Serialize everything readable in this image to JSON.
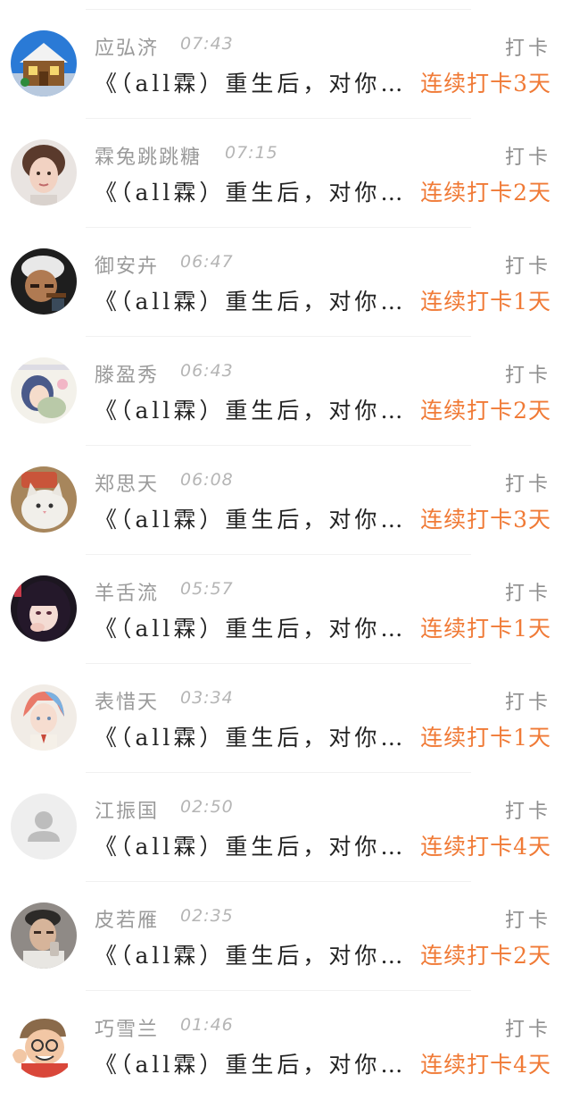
{
  "items": [
    {
      "name": "应弘济",
      "time": "07:43",
      "action": "打卡",
      "title": "《（all霖）重生后，对你…",
      "streak": "连续打卡3天",
      "avatar": "house-avatar"
    },
    {
      "name": "霖兔跳跳糖",
      "time": "07:15",
      "action": "打卡",
      "title": "《（all霖）重生后，对你…",
      "streak": "连续打卡2天",
      "avatar": "boy-portrait-avatar"
    },
    {
      "name": "御安卉",
      "time": "06:47",
      "action": "打卡",
      "title": "《（all霖）重生后，对你…",
      "streak": "连续打卡1天",
      "avatar": "cigar-man-avatar"
    },
    {
      "name": "滕盈秀",
      "time": "06:43",
      "action": "打卡",
      "title": "《（all霖）重生后，对你…",
      "streak": "连续打卡2天",
      "avatar": "anime-girl-avatar"
    },
    {
      "name": "郑思天",
      "time": "06:08",
      "action": "打卡",
      "title": "《（all霖）重生后，对你…",
      "streak": "连续打卡3天",
      "avatar": "cat-avatar"
    },
    {
      "name": "羊舌流",
      "time": "05:57",
      "action": "打卡",
      "title": "《（all霖）重生后，对你…",
      "streak": "连续打卡1天",
      "avatar": "dark-hair-girl-avatar"
    },
    {
      "name": "表惜天",
      "time": "03:34",
      "action": "打卡",
      "title": "《（all霖）重生后，对你…",
      "streak": "连续打卡1天",
      "avatar": "colorful-hair-avatar"
    },
    {
      "name": "江振国",
      "time": "02:50",
      "action": "打卡",
      "title": "《（all霖）重生后，对你…",
      "streak": "连续打卡4天",
      "avatar": "default-user-avatar"
    },
    {
      "name": "皮若雁",
      "time": "02:35",
      "action": "打卡",
      "title": "《（all霖）重生后，对你…",
      "streak": "连续打卡2天",
      "avatar": "man-photo-avatar"
    },
    {
      "name": "巧雪兰",
      "time": "01:46",
      "action": "打卡",
      "title": "《（all霖）重生后，对你…",
      "streak": "连续打卡4天",
      "avatar": "cartoon-grandpa-avatar"
    }
  ],
  "colors": {
    "name": "#9a9a9a",
    "time": "#b5b5b5",
    "action": "#8e8e8e",
    "title": "#222222",
    "streak": "#f07a36"
  }
}
